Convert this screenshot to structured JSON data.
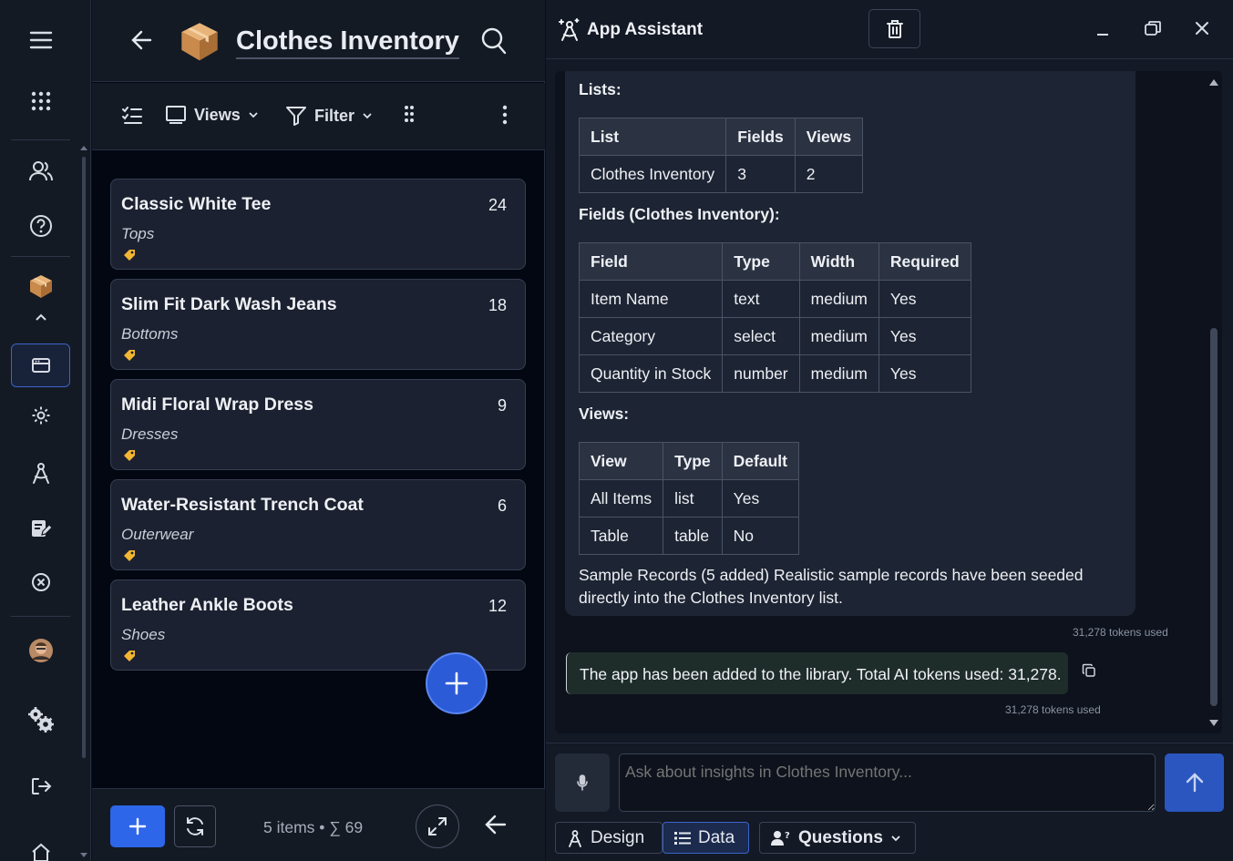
{
  "rail": {
    "items": [
      "menu-icon",
      "apps-grid-icon",
      "users-icon",
      "help-icon",
      "app-box-icon",
      "chevron-up-icon",
      "app-window-icon",
      "gear-icon",
      "assistant-icon",
      "edit-icon",
      "close-circle-icon",
      "avatar",
      "settings-cogs-icon",
      "logout-icon",
      "home-icon"
    ]
  },
  "list_panel": {
    "title": "Clothes Inventory",
    "toolbar": {
      "views_label": "Views",
      "filter_label": "Filter"
    },
    "items": [
      {
        "name": "Classic White Tee",
        "category": "Tops",
        "quantity": "24"
      },
      {
        "name": "Slim Fit Dark Wash Jeans",
        "category": "Bottoms",
        "quantity": "18"
      },
      {
        "name": "Midi Floral Wrap Dress",
        "category": "Dresses",
        "quantity": "9"
      },
      {
        "name": "Water-Resistant Trench Coat",
        "category": "Outerwear",
        "quantity": "6"
      },
      {
        "name": "Leather Ankle Boots",
        "category": "Shoes",
        "quantity": "12"
      }
    ],
    "footer": {
      "count_text": "5 items • ∑ 69"
    }
  },
  "assistant": {
    "title": "App Assistant",
    "lists_heading": "Lists:",
    "lists_table": {
      "headers": [
        "List",
        "Fields",
        "Views"
      ],
      "rows": [
        [
          "Clothes Inventory",
          "3",
          "2"
        ]
      ]
    },
    "fields_heading": "Fields (Clothes Inventory):",
    "fields_table": {
      "headers": [
        "Field",
        "Type",
        "Width",
        "Required"
      ],
      "rows": [
        [
          "Item Name",
          "text",
          "medium",
          "Yes"
        ],
        [
          "Category",
          "select",
          "medium",
          "Yes"
        ],
        [
          "Quantity in Stock",
          "number",
          "medium",
          "Yes"
        ]
      ]
    },
    "views_heading": "Views:",
    "views_table": {
      "headers": [
        "View",
        "Type",
        "Default"
      ],
      "rows": [
        [
          "All Items",
          "list",
          "Yes"
        ],
        [
          "Table",
          "table",
          "No"
        ]
      ]
    },
    "sample_line1": "Sample Records (5 added) Realistic sample records have been seeded",
    "sample_line2": "directly into the Clothes Inventory list.",
    "tokens_1": "31,278 tokens used",
    "reply_text": "The app has been added to the library. Total AI tokens used: 31,278.",
    "tokens_2": "31,278 tokens used",
    "input_placeholder": "Ask about insights in Clothes Inventory...",
    "tabs": {
      "design": "Design",
      "data": "Data",
      "questions": "Questions"
    }
  },
  "colors": {
    "accent": "#2d66e8",
    "panel": "#141a24",
    "card": "#1b2130",
    "background": "#030711"
  }
}
